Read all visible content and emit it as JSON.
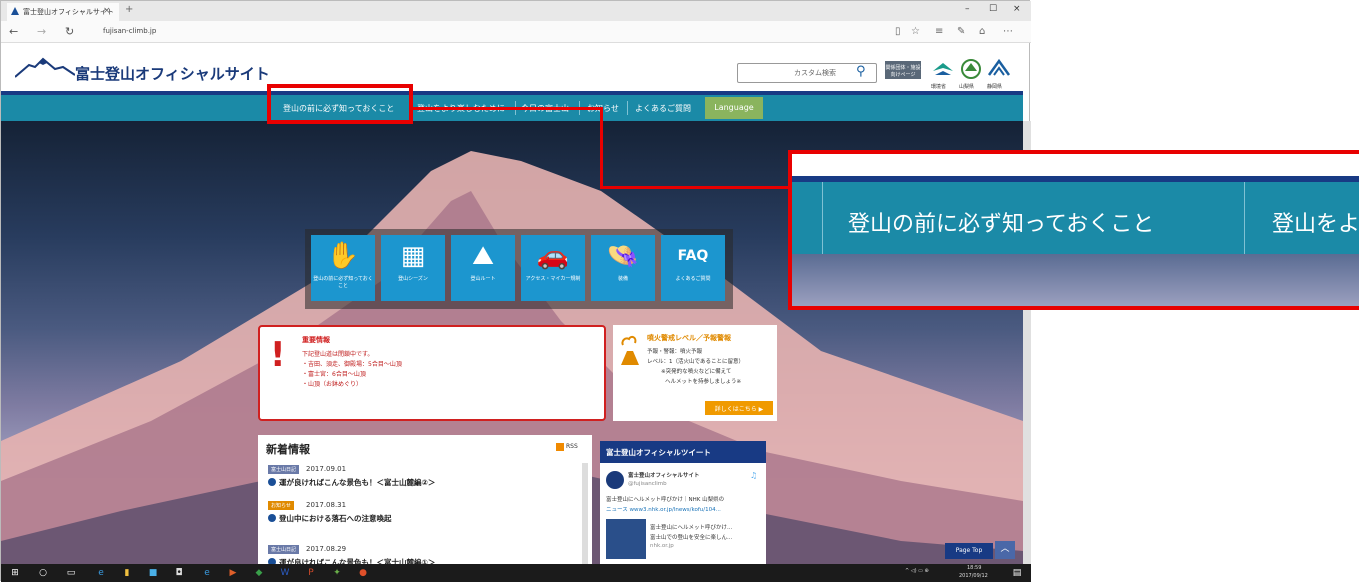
{
  "browser": {
    "tab_title": "富士登山オフィシャルサイト",
    "tab_close": "×",
    "new_tab": "+",
    "url": "fujisan-climb.jp",
    "win_min": "–",
    "win_max": "☐",
    "win_close": "×"
  },
  "site": {
    "name": "富士登山オフィシャルサイト",
    "search_placeholder": "カスタム検索",
    "header_button": "関係団体・施設向けページ",
    "prefectures": [
      "環境省",
      "山梨県",
      "静岡県"
    ],
    "nav": [
      "登山の前に必ず知っておくこと",
      "登山をより楽しむために",
      "今日の富士山",
      "お知らせ",
      "よくあるご質問"
    ],
    "language": "Language"
  },
  "icons": [
    {
      "label": "登山の前に必ず知っておくこと",
      "glyph": "✋",
      "icon": "hand-icon"
    },
    {
      "label": "登山シーズン",
      "glyph": "▦",
      "icon": "calendar-icon"
    },
    {
      "label": "登山ルート",
      "glyph": "⛰",
      "icon": "route-icon"
    },
    {
      "label": "アクセス・マイカー規制",
      "glyph": "🚗",
      "icon": "car-icon"
    },
    {
      "label": "装備",
      "glyph": "👒",
      "icon": "equipment-icon"
    },
    {
      "label": "よくあるご質問",
      "glyph": "FAQ",
      "icon": "faq-icon"
    }
  ],
  "alert": {
    "title": "重要情報",
    "lines": [
      "下記登山道は閉鎖中です。",
      "・吉田、須走、御殿場：5合目〜山頂",
      "・富士宮：6合目〜山頂",
      "・山頂（お鉢めぐり）"
    ]
  },
  "volcano": {
    "title": "噴火警戒レベル／予報警報",
    "lines": [
      "予報・警報：噴火予報",
      "レベル：1（活火山であることに留意）",
      "※突発的な噴火などに備えて",
      "ヘルメットを持参しましょう※"
    ],
    "button": "詳しくはこちら ▶"
  },
  "news": {
    "heading": "新着情報",
    "rss": "RSS",
    "items": [
      {
        "tag": "富士山日記",
        "tag_color": "#6a7aa8",
        "date": "2017.09.01",
        "title": "運が良ければこんな景色も！＜富士山麓編②＞"
      },
      {
        "tag": "お知らせ",
        "tag_color": "#e08a00",
        "date": "2017.08.31",
        "title": "登山中における落石への注意喚起"
      },
      {
        "tag": "富士山日記",
        "tag_color": "#6a7aa8",
        "date": "2017.08.29",
        "title": "運が良ければこんな景色も！＜富士山麓編①＞"
      }
    ]
  },
  "tweets": {
    "heading": "富士登山オフィシャルツイート",
    "account": "富士登山オフィシャルサイト",
    "handle": "@fujisanclimb",
    "text1": "富士登山にヘルメット呼びかけ｜NHK 山梨県の",
    "text2": "ニュース www3.nhk.or.jp/lnews/kofu/104...",
    "card1": "富士登山にヘルメット呼びかけ...",
    "card2": "富士山での登山を安全に楽しん...",
    "card3": "nhk.or.jp"
  },
  "page_top": "Page Top",
  "zoom": {
    "item1": "登山の前に必ず知っておくこと",
    "item2": "登山をよ"
  },
  "taskbar": {
    "time": "18:59",
    "date": "2017/09/12"
  }
}
